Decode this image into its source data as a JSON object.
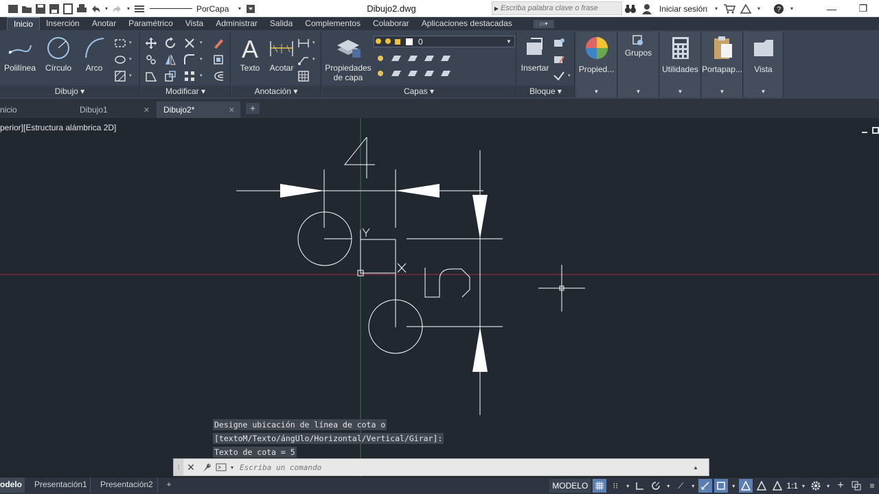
{
  "app": {
    "document_title": "Dibujo2.dwg",
    "linetype_value": "PorCapa",
    "search_placeholder": "Escriba palabra clave o frase",
    "signin_label": "Iniciar sesión"
  },
  "ribbon": {
    "tabs": [
      "Inicio",
      "Inserción",
      "Anotar",
      "Paramétrico",
      "Vista",
      "Administrar",
      "Salida",
      "Complementos",
      "Colaborar",
      "Aplicaciones destacadas"
    ],
    "active_tab": "Inicio",
    "draw": {
      "polyline": "Polilínea",
      "circle": "Círculo",
      "arc": "Arco",
      "title": "Dibujo"
    },
    "modify": {
      "title": "Modificar"
    },
    "annotation": {
      "text": "Texto",
      "dimension": "Acotar",
      "title": "Anotación"
    },
    "layers": {
      "properties_line1": "Propiedades",
      "properties_line2": "de capa",
      "current_layer": "0",
      "title": "Capas"
    },
    "block": {
      "insert": "Insertar",
      "title": "Bloque"
    },
    "tiles": {
      "properties": "Propied...",
      "groups": "Grupos",
      "utilities": "Utilidades",
      "clipboard": "Portapap...",
      "view": "Vista"
    }
  },
  "file_tabs": [
    {
      "label": "nicio"
    },
    {
      "label": "Dibujo1"
    },
    {
      "label": "Dibujo2*"
    }
  ],
  "viewport": {
    "label": "perior][Estructura alámbrica 2D]"
  },
  "drawing": {
    "dim_text_top": "4",
    "dim_text_right": "5",
    "ucs_y": "Y",
    "ucs_x": "X"
  },
  "command": {
    "history": [
      "Designe ubicación de línea de cota o",
      "[textoM/Texto/ángUlo/Horizontal/Vertical/Girar]:",
      "Texto de cota = 5"
    ],
    "placeholder": "Escriba un comando"
  },
  "layout_tabs": [
    "odelo",
    "Presentación1",
    "Presentación2"
  ],
  "status": {
    "model_label": "MODELO",
    "scale": "1:1"
  },
  "colors": {
    "canvas_bg": "#212830",
    "ribbon_bg": "#3b4452",
    "geometry": "#ffffff",
    "x_axis": "#a0303a",
    "y_axis": "#2f7a3a",
    "status_active": "#5b7fb3"
  },
  "icons": [
    "new-icon",
    "open-icon",
    "save-icon",
    "saveas-icon",
    "web-icon",
    "print-icon",
    "undo-icon",
    "redo-icon",
    "search-binoculars-icon",
    "user-icon",
    "cart-icon",
    "autodesk-icon",
    "help-icon",
    "move-icon",
    "rotate-icon",
    "trim-icon",
    "erase-icon",
    "copy-icon",
    "mirror-icon",
    "fillet-icon",
    "explode-icon",
    "stretch-icon",
    "scale-icon",
    "array-icon",
    "offset-icon",
    "layer-bulb-icon",
    "grid-icon",
    "snap-icon",
    "ortho-icon",
    "polar-icon",
    "osnap-icon",
    "workspace-gear-icon"
  ]
}
